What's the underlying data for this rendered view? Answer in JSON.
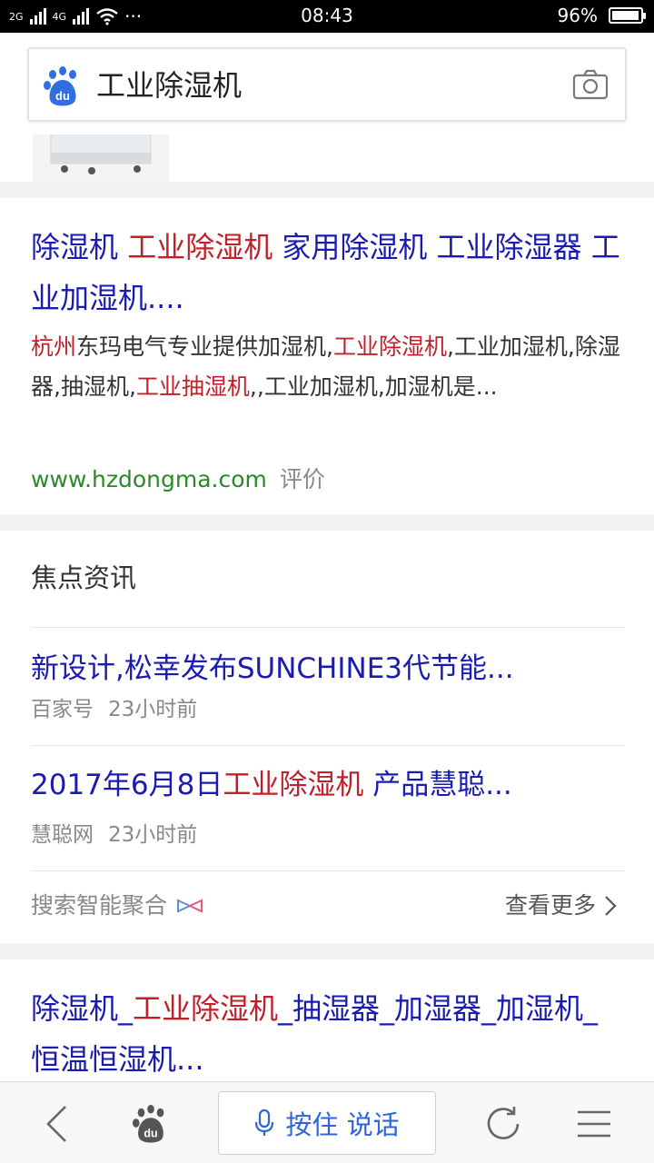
{
  "status_bar": {
    "network_left": "2G",
    "network_right": "4G",
    "more": "···",
    "time": "08:43",
    "battery_percent": "96%",
    "battery_level": 0.96
  },
  "search": {
    "query": "工业除湿机",
    "logo_icon": "baidu-paw-icon",
    "camera_icon": "camera-icon"
  },
  "result1": {
    "title_parts": [
      "除湿机 ",
      "工业除湿机",
      " 家用除湿机 工业除湿器 工业加湿机...."
    ],
    "desc_parts": [
      "杭州",
      "东玛电气专业提供加湿机,",
      "工业除湿机",
      ",工业加湿机,除湿器,抽湿机,",
      "工业抽湿机",
      ",,工业加湿机,加湿机是..."
    ],
    "url": "www.hzdongma.com",
    "eval_label": "评价"
  },
  "news": {
    "header": "焦点资讯",
    "items": [
      {
        "title_parts": [
          "新设计,松幸发布SUNCHINE3代节能...",
          "",
          ""
        ],
        "source": "百家号",
        "time": "23小时前"
      },
      {
        "title_parts": [
          "2017年6月8日",
          "工业除湿机",
          " 产品慧聪..."
        ],
        "source": "慧聪网",
        "time": "23小时前"
      }
    ],
    "aggregate_label": "搜索智能聚合",
    "more_label": "查看更多"
  },
  "result2": {
    "title_parts": [
      "除湿机_",
      "工业除湿机",
      "_抽湿器_加湿器_加湿机_恒温恒湿机..."
    ]
  },
  "bottom_nav": {
    "back_icon": "back-chevron-icon",
    "home_icon": "baidu-paw-icon",
    "voice_label": "按住 说话",
    "refresh_icon": "refresh-icon",
    "menu_icon": "menu-icon"
  },
  "colors": {
    "link_blue": "#1a1bb0",
    "highlight_red": "#c0202a",
    "url_green": "#2a8a2a",
    "voice_blue": "#3164d8"
  }
}
